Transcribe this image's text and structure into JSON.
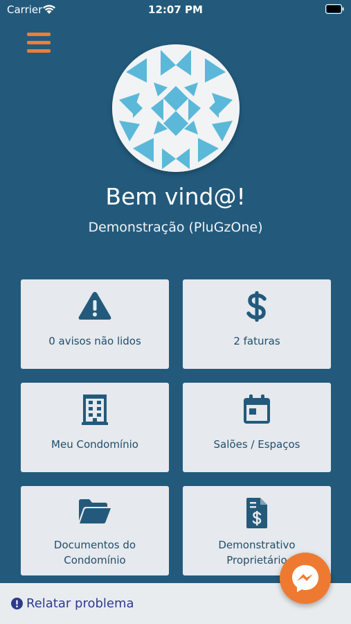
{
  "status_bar": {
    "carrier": "Carrier",
    "time": "12:07 PM"
  },
  "colors": {
    "background": "#235a7c",
    "accent": "#f07e34",
    "card": "#e6e9ed",
    "icon": "#235a7c",
    "link": "#2d3a8c"
  },
  "header": {
    "title": "Bem vind@!",
    "subtitle": "Demonstração (PluGzOne)"
  },
  "cards": [
    {
      "icon": "warning-icon",
      "label": "0 avisos não lidos"
    },
    {
      "icon": "dollar-icon",
      "label": "2 faturas"
    },
    {
      "icon": "building-icon",
      "label": "Meu Condomínio"
    },
    {
      "icon": "calendar-icon",
      "label": "Salões / Espaços"
    },
    {
      "icon": "folder-icon",
      "label": "Documentos do Condomínio"
    },
    {
      "icon": "invoice-icon",
      "label": "Demonstrativo Proprietário"
    }
  ],
  "footer": {
    "report_label": "Relatar problema",
    "chat_icon": "messenger-icon"
  }
}
